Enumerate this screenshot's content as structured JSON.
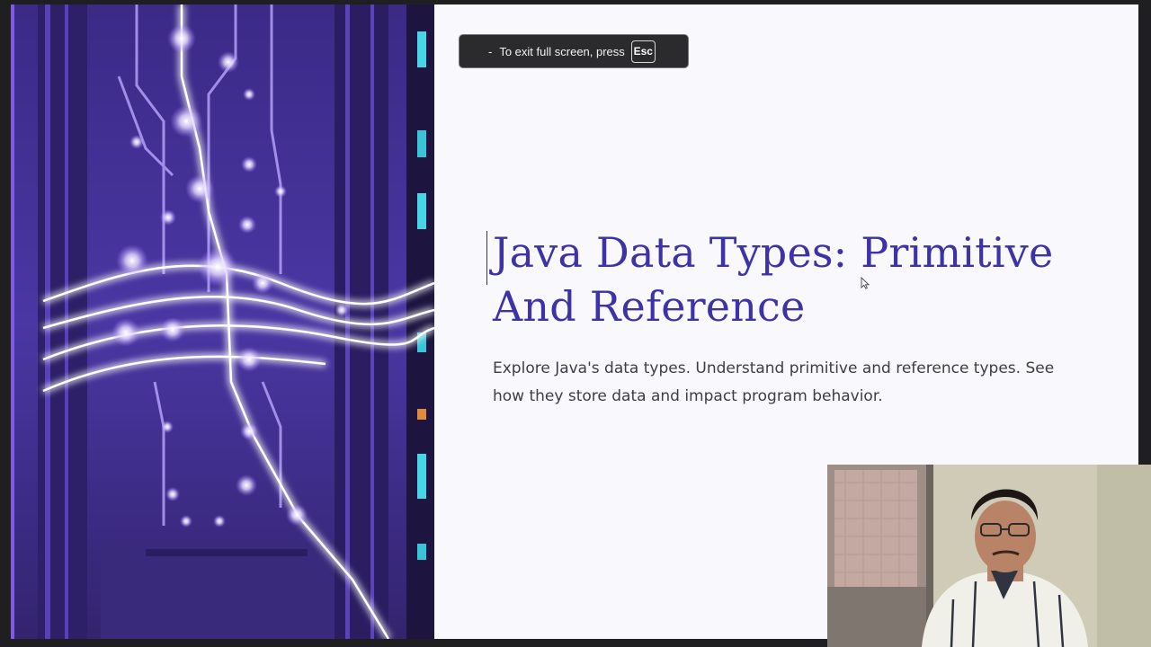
{
  "slide": {
    "title_line1": "Java Data Types: Primitive",
    "title_line2": "And Reference",
    "subtitle": "Explore Java's data types. Understand primitive and reference types. See how they store data and impact program behavior.",
    "image": "glowing-circuit-lines-server-rack",
    "accent_color": "#3d32a8"
  },
  "fullscreen_notice": {
    "dash": "-",
    "text": "To exit full screen, press",
    "key": "Esc"
  },
  "icons": {
    "pointer": "mouse-pointer-icon"
  },
  "webcam": {
    "content": "presenter-webcam-overlay"
  }
}
